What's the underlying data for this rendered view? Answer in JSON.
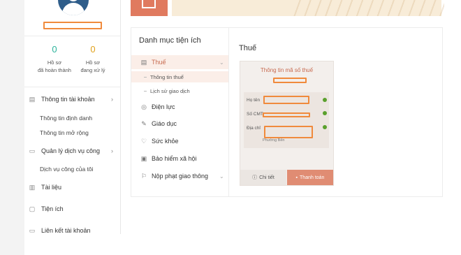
{
  "user": {
    "stats": [
      {
        "value": "0",
        "label_line1": "Hồ sơ",
        "label_line2": "đã hoàn thành",
        "color": "#2bb39b"
      },
      {
        "value": "0",
        "label_line1": "Hồ sơ",
        "label_line2": "đang xử lý",
        "color": "#e0a11b"
      }
    ]
  },
  "sidebar": {
    "account": {
      "label": "Thông tin tài khoản",
      "icon": "id-card-icon"
    },
    "account_sub": [
      "Thông tin định danh",
      "Thông tin mở rộng"
    ],
    "services": {
      "label": "Quản lý dịch vụ công",
      "icon": "folder-icon"
    },
    "services_sub": [
      "Dịch vụ công của tôi"
    ],
    "documents": {
      "label": "Tài liệu",
      "icon": "document-icon"
    },
    "utilities": {
      "label": "Tiện ích",
      "icon": "utility-icon"
    },
    "linked": {
      "label": "Liên kết tài khoản",
      "icon": "link-icon"
    }
  },
  "categories": {
    "title": "Danh mục tiện ích",
    "tax": {
      "label": "Thuế",
      "icon": "tax-icon"
    },
    "tax_sub": [
      "Thông tin thuế",
      "Lịch sử giao dịch"
    ],
    "items": [
      {
        "label": "Điện lực",
        "icon": "power-icon"
      },
      {
        "label": "Giáo dục",
        "icon": "education-icon"
      },
      {
        "label": "Sức khỏe",
        "icon": "health-icon"
      },
      {
        "label": "Bảo hiểm xã hội",
        "icon": "insurance-icon"
      },
      {
        "label": "Nộp phạt giao thông",
        "icon": "traffic-icon"
      }
    ]
  },
  "detail": {
    "title": "Thuế",
    "panel_title": "Thông tin mã số thuế",
    "fields": {
      "name": "Họ tên",
      "id": "Số CMT",
      "address": "Địa chỉ"
    },
    "address_extra": "Phường Bến",
    "detail_button": "Chi tiết",
    "pay_button": "Thanh toán"
  },
  "colors": {
    "accent": "#e07a5f",
    "highlight": "#fbeee8",
    "redaction": "#f08a3c"
  }
}
